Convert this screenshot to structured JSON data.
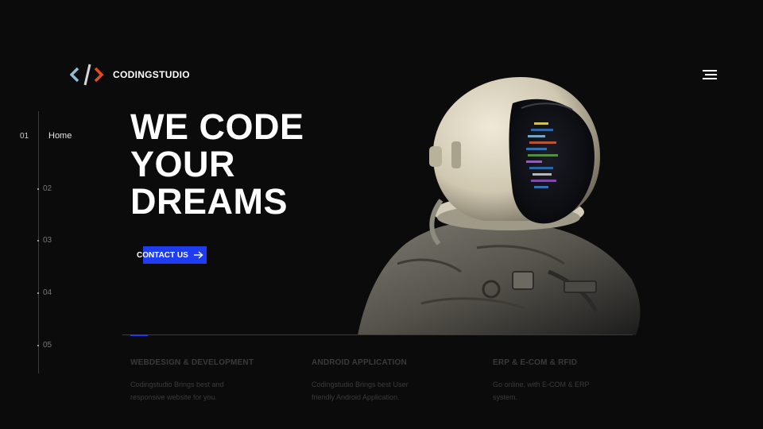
{
  "brand": {
    "name": "CODINGSTUDIO",
    "icon": "code-brackets-icon",
    "colors": {
      "left": "#8fbcd4",
      "slash": "#d6d6d6",
      "right": "#e8491d"
    }
  },
  "header": {
    "menu_icon": "hamburger-menu-icon"
  },
  "sidenav": {
    "active": {
      "number": "01",
      "label": "Home"
    },
    "items": [
      "02",
      "03",
      "04",
      "05"
    ]
  },
  "hero": {
    "lines": [
      "WE CODE",
      "YOUR",
      "DREAMS"
    ],
    "cta_label": "CONTACT US",
    "cta_icon": "arrow-right-icon",
    "accent": "#1e3cf0"
  },
  "services": [
    {
      "title": "WEBDESIGN & DEVELOPMENT",
      "desc_lines": [
        "Codingstudio Brings best and",
        "responsive website for you."
      ]
    },
    {
      "title": "ANDROID APPLICATION",
      "desc_lines": [
        "Codingstudio Brings best User",
        "friendly Android Application."
      ]
    },
    {
      "title": "ERP & E-COM & RFID",
      "desc_lines": [
        "Go online, with E-COM & ERP",
        "system."
      ]
    }
  ]
}
